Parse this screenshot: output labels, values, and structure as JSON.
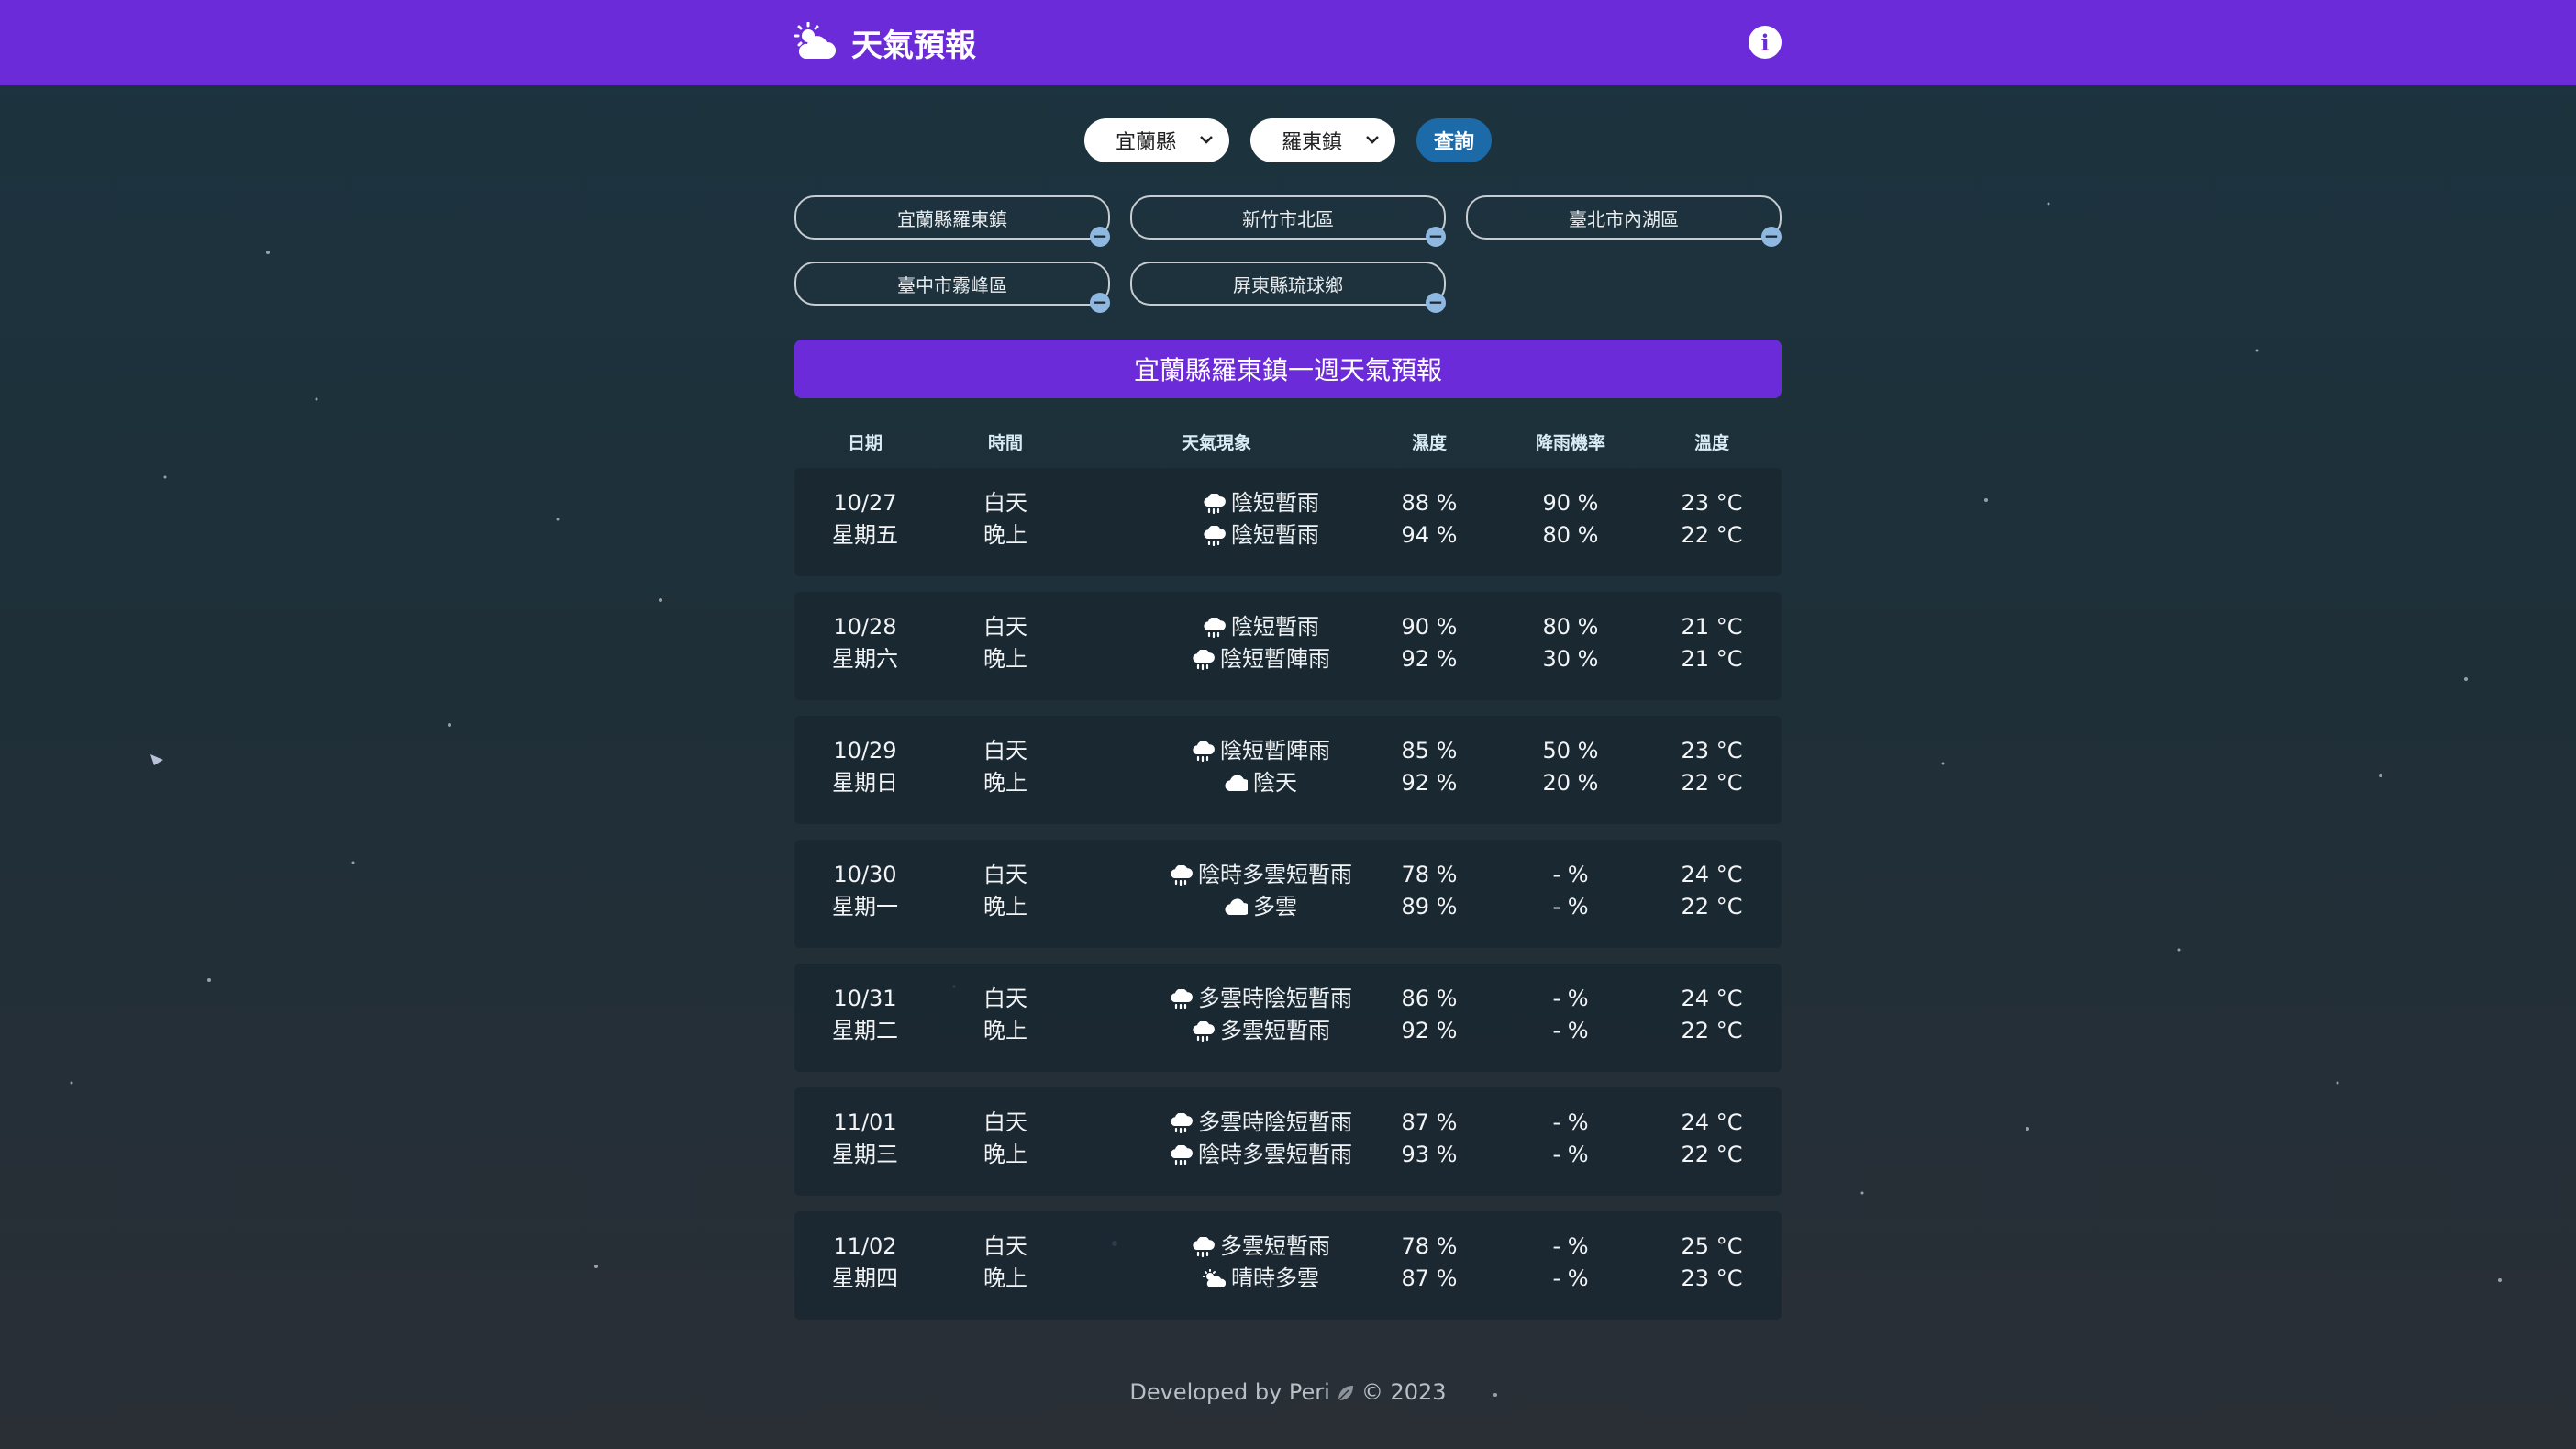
{
  "header": {
    "title": "天氣預報",
    "logo_icon": "cloud-sun-icon",
    "info_icon": "info-icon"
  },
  "search": {
    "county": "宜蘭縣",
    "town": "羅東鎮",
    "query_label": "查詢"
  },
  "favorites": [
    "宜蘭縣羅東鎮",
    "新竹市北區",
    "臺北市內湖區",
    "臺中市霧峰區",
    "屏東縣琉球鄉"
  ],
  "forecast": {
    "title": "宜蘭縣羅東鎮一週天氣預報",
    "columns": [
      "日期",
      "時間",
      "天氣現象",
      "濕度",
      "降雨機率",
      "溫度"
    ],
    "days": [
      {
        "date": "10/27",
        "weekday": "星期五",
        "day": {
          "period": "白天",
          "icon": "rain-icon",
          "weather": "陰短暫雨",
          "humidity": "88 %",
          "rain": "90 %",
          "temp": "23 °C"
        },
        "night": {
          "period": "晚上",
          "icon": "rain-icon",
          "weather": "陰短暫雨",
          "humidity": "94 %",
          "rain": "80 %",
          "temp": "22 °C"
        }
      },
      {
        "date": "10/28",
        "weekday": "星期六",
        "day": {
          "period": "白天",
          "icon": "rain-icon",
          "weather": "陰短暫雨",
          "humidity": "90 %",
          "rain": "80 %",
          "temp": "21 °C"
        },
        "night": {
          "period": "晚上",
          "icon": "rain-icon",
          "weather": "陰短暫陣雨",
          "humidity": "92 %",
          "rain": "30 %",
          "temp": "21 °C"
        }
      },
      {
        "date": "10/29",
        "weekday": "星期日",
        "day": {
          "period": "白天",
          "icon": "rain-icon",
          "weather": "陰短暫陣雨",
          "humidity": "85 %",
          "rain": "50 %",
          "temp": "23 °C"
        },
        "night": {
          "period": "晚上",
          "icon": "cloud-icon",
          "weather": "陰天",
          "humidity": "92 %",
          "rain": "20 %",
          "temp": "22 °C"
        }
      },
      {
        "date": "10/30",
        "weekday": "星期一",
        "day": {
          "period": "白天",
          "icon": "rain-icon",
          "weather": "陰時多雲短暫雨",
          "humidity": "78 %",
          "rain": "- %",
          "temp": "24 °C"
        },
        "night": {
          "period": "晚上",
          "icon": "cloud-icon",
          "weather": "多雲",
          "humidity": "89 %",
          "rain": "- %",
          "temp": "22 °C"
        }
      },
      {
        "date": "10/31",
        "weekday": "星期二",
        "day": {
          "period": "白天",
          "icon": "rain-icon",
          "weather": "多雲時陰短暫雨",
          "humidity": "86 %",
          "rain": "- %",
          "temp": "24 °C"
        },
        "night": {
          "period": "晚上",
          "icon": "rain-icon",
          "weather": "多雲短暫雨",
          "humidity": "92 %",
          "rain": "- %",
          "temp": "22 °C"
        }
      },
      {
        "date": "11/01",
        "weekday": "星期三",
        "day": {
          "period": "白天",
          "icon": "rain-icon",
          "weather": "多雲時陰短暫雨",
          "humidity": "87 %",
          "rain": "- %",
          "temp": "24 °C"
        },
        "night": {
          "period": "晚上",
          "icon": "rain-icon",
          "weather": "陰時多雲短暫雨",
          "humidity": "93 %",
          "rain": "- %",
          "temp": "22 °C"
        }
      },
      {
        "date": "11/02",
        "weekday": "星期四",
        "day": {
          "period": "白天",
          "icon": "rain-icon",
          "weather": "多雲短暫雨",
          "humidity": "78 %",
          "rain": "- %",
          "temp": "25 °C"
        },
        "night": {
          "period": "晚上",
          "icon": "sun-cloud-icon",
          "weather": "晴時多雲",
          "humidity": "87 %",
          "rain": "- %",
          "temp": "23 °C"
        }
      }
    ]
  },
  "footer": {
    "prefix": "Developed by Peri",
    "leaf_icon": "leaf-icon",
    "suffix": "© 2023"
  },
  "colors": {
    "header": "#6c2bd9",
    "query_button": "#1d6aa8",
    "background": "#1e2f38"
  }
}
